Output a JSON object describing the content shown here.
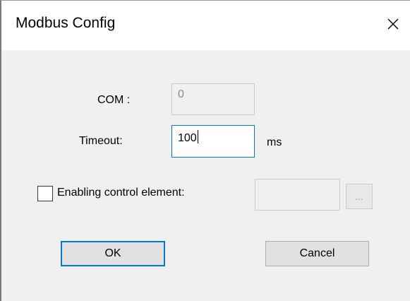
{
  "window": {
    "title": "Modbus Config",
    "close_icon": "close-icon"
  },
  "form": {
    "com": {
      "label": "COM :",
      "value": "0",
      "enabled": false
    },
    "timeout": {
      "label": "Timeout:",
      "value": "100",
      "unit": "ms"
    },
    "enabling_control": {
      "label": "Enabling control element:",
      "checked": false,
      "value": "",
      "browse_label": "..."
    }
  },
  "buttons": {
    "ok": "OK",
    "cancel": "Cancel"
  },
  "colors": {
    "accent": "#0078d7",
    "window_bg": "#f0f0f0",
    "titlebar_bg": "#ffffff"
  }
}
